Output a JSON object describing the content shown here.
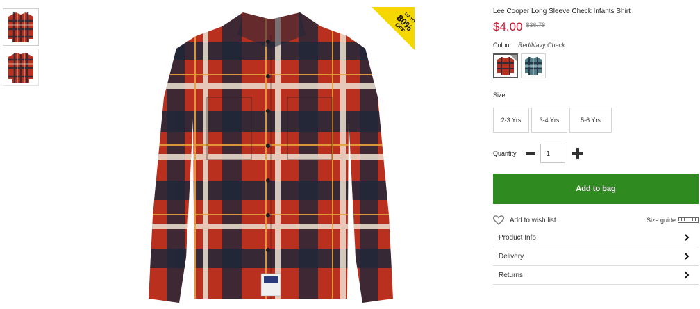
{
  "product": {
    "title": "Lee Cooper Long Sleeve Check Infants Shirt",
    "price": "$4.00",
    "was_price": "$36.78",
    "promo_badge": {
      "line1": "UP TO",
      "line2": "80%",
      "line3": "OFF"
    }
  },
  "colour": {
    "label": "Colour",
    "value": "Red/Navy Check",
    "swatches": [
      {
        "name": "Red/Navy Check",
        "selected": true
      },
      {
        "name": "Teal Check",
        "selected": false
      }
    ]
  },
  "size": {
    "label": "Size",
    "options": [
      "2-3 Yrs",
      "3-4 Yrs",
      "5-6 Yrs"
    ]
  },
  "quantity": {
    "label": "Quantity",
    "value": "1"
  },
  "actions": {
    "add_to_bag": "Add to bag",
    "wish_list": "Add to wish list",
    "size_guide": "Size guide"
  },
  "accordion": [
    {
      "label": "Product Info"
    },
    {
      "label": "Delivery"
    },
    {
      "label": "Returns"
    }
  ],
  "colors": {
    "price_red": "#c8102e",
    "add_to_bag_green": "#2f8a1f",
    "promo_yellow": "#f5d800"
  },
  "icons": {
    "wish": "heart-icon",
    "size_guide": "ruler-icon",
    "accordion": "chevron-right-icon",
    "minus": "minus-icon",
    "plus": "plus-icon"
  }
}
